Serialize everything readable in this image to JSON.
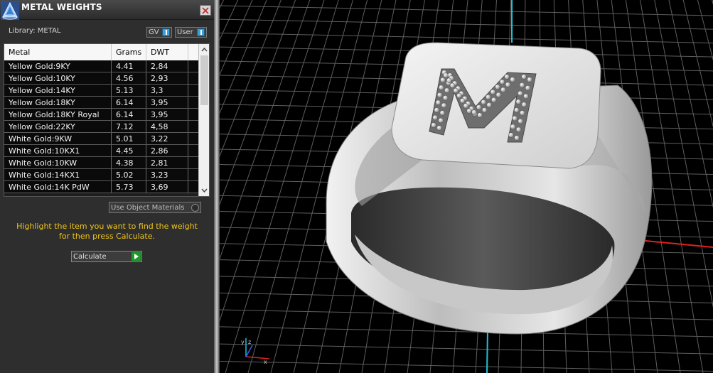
{
  "panel": {
    "title": "METAL WEIGHTS",
    "library_label": "Library: METAL",
    "gv_label": "GV",
    "user_label": "User",
    "columns": [
      "Metal",
      "Grams",
      "DWT"
    ],
    "rows": [
      {
        "metal": "Yellow Gold:9KY",
        "grams": "4.41",
        "dwt": "2,84"
      },
      {
        "metal": "Yellow Gold:10KY",
        "grams": "4.56",
        "dwt": "2,93"
      },
      {
        "metal": "Yellow Gold:14KY",
        "grams": "5.13",
        "dwt": "3,3"
      },
      {
        "metal": "Yellow Gold:18KY",
        "grams": "6.14",
        "dwt": "3,95"
      },
      {
        "metal": "Yellow Gold:18KY Royal",
        "grams": "6.14",
        "dwt": "3,95"
      },
      {
        "metal": "Yellow Gold:22KY",
        "grams": "7.12",
        "dwt": "4,58"
      },
      {
        "metal": "White Gold:9KW",
        "grams": "5.01",
        "dwt": "3,22"
      },
      {
        "metal": "White Gold:10KX1",
        "grams": "4.45",
        "dwt": "2,86"
      },
      {
        "metal": "White Gold:10KW",
        "grams": "4.38",
        "dwt": "2,81"
      },
      {
        "metal": "White Gold:14KX1",
        "grams": "5.02",
        "dwt": "3,23"
      },
      {
        "metal": "White Gold:14K PdW",
        "grams": "5.73",
        "dwt": "3,69"
      }
    ],
    "use_object_materials_label": "Use Object Materials",
    "hint_line1": "Highlight the item you want to find the weight",
    "hint_line2": "for then press Calculate.",
    "calculate_label": "Calculate"
  },
  "viewport": {
    "axis_colors": {
      "x": "#e02020",
      "y": "#20c0d8",
      "z": "#3060ff"
    },
    "model": "signet ring with pavé letter",
    "engraved_letter": "M"
  },
  "colors": {
    "hint": "#f0c419",
    "accent_blue": "#3aa0d8",
    "calculate_green": "#1e9a2a"
  }
}
